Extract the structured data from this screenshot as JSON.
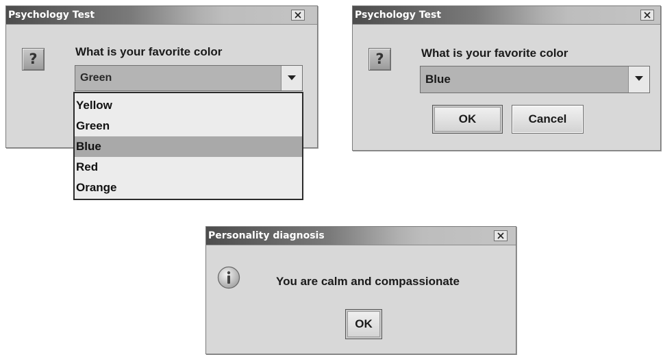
{
  "dialog_left": {
    "title": "Psychology Test",
    "close_icon": "close-icon",
    "question_icon_glyph": "?",
    "prompt": "What is your favorite color",
    "combo": {
      "selected": "Green",
      "arrow_icon": "chevron-down-icon"
    },
    "dropdown": {
      "options": [
        "Yellow",
        "Green",
        "Blue",
        "Red",
        "Orange"
      ],
      "highlighted": "Blue"
    }
  },
  "dialog_right": {
    "title": "Psychology Test",
    "close_icon": "close-icon",
    "question_icon_glyph": "?",
    "prompt": "What is your favorite color",
    "combo": {
      "selected": "Blue",
      "arrow_icon": "chevron-down-icon"
    },
    "buttons": {
      "ok": "OK",
      "cancel": "Cancel"
    }
  },
  "dialog_bottom": {
    "title": "Personality diagnosis",
    "close_icon": "close-icon",
    "info_icon": "info-icon",
    "message": "You are calm and compassionate",
    "buttons": {
      "ok": "OK"
    }
  },
  "colors": {
    "dialog_bg": "#d8d8d8",
    "titlebar_dark": "#4d4d4d",
    "titlebar_light": "#c4c4c4",
    "combo_bg": "#b4b4b4",
    "dropdown_bg": "#ececec",
    "highlight": "#a9a9a9"
  }
}
